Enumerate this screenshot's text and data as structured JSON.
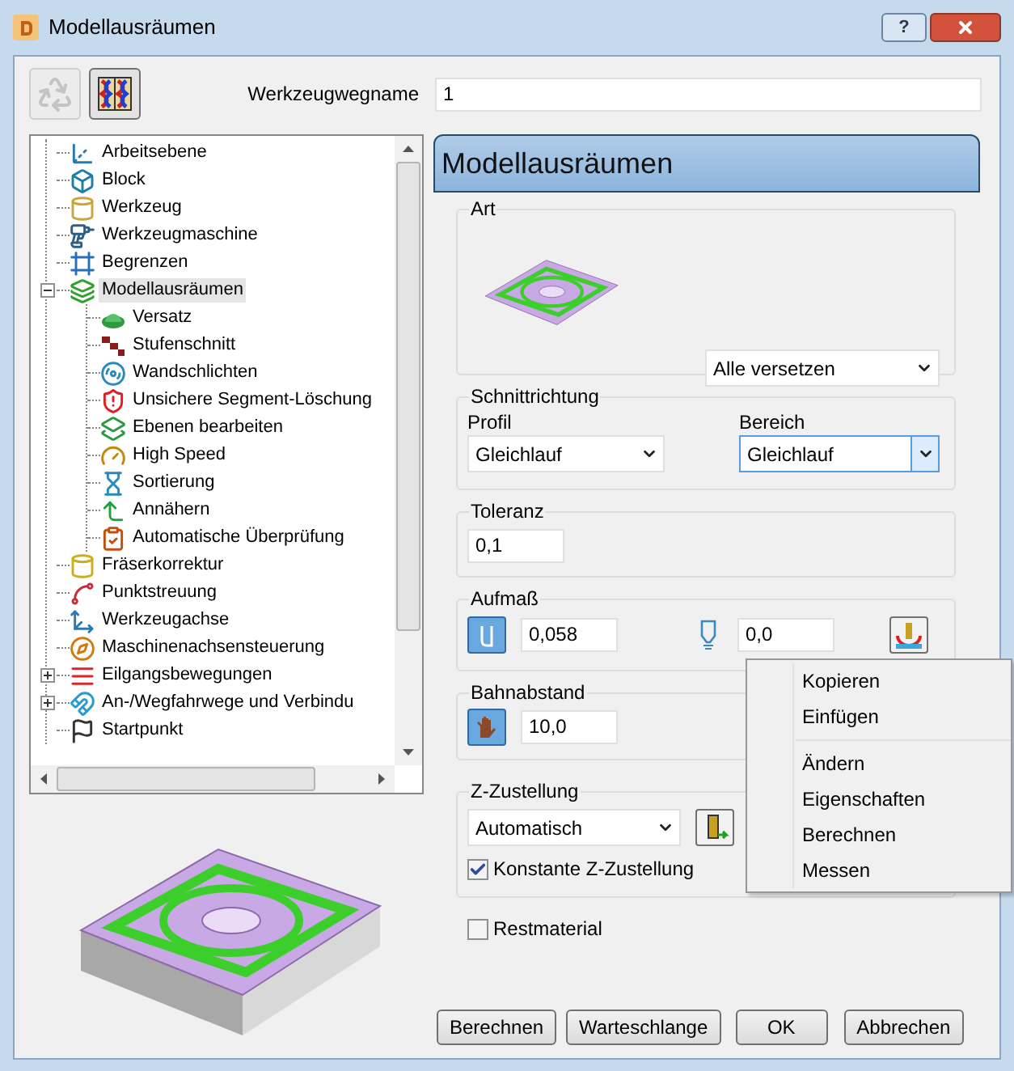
{
  "window": {
    "title": "Modellausräumen",
    "help": "?"
  },
  "toolbar": [
    {
      "disabled": true
    },
    {
      "disabled": false
    }
  ],
  "name_field": {
    "label": "Werkzeugwegname",
    "value": "1"
  },
  "tree": {
    "items": [
      {
        "label": "Arbeitsebene",
        "selected": false
      },
      {
        "label": "Block",
        "selected": false
      },
      {
        "label": "Werkzeug",
        "selected": false
      },
      {
        "label": "Werkzeugmaschine",
        "selected": false
      },
      {
        "label": "Begrenzen",
        "selected": false
      },
      {
        "label": "Modellausräumen",
        "selected": true,
        "expanded": true,
        "children": [
          {
            "label": "Versatz",
            "selected": false
          },
          {
            "label": "Stufenschnitt",
            "selected": false
          },
          {
            "label": "Wandschlichten",
            "selected": false
          },
          {
            "label": "Unsichere Segment-Löschung",
            "selected": false
          },
          {
            "label": "Ebenen bearbeiten",
            "selected": false
          },
          {
            "label": "High Speed",
            "selected": false
          },
          {
            "label": "Sortierung",
            "selected": false
          },
          {
            "label": "Annähern",
            "selected": false
          },
          {
            "label": "Automatische Überprüfung",
            "selected": false
          }
        ]
      },
      {
        "label": "Fräserkorrektur",
        "selected": false
      },
      {
        "label": "Punktstreuung",
        "selected": false
      },
      {
        "label": "Werkzeugachse",
        "selected": false
      },
      {
        "label": "Maschinenachsensteuerung",
        "selected": false
      },
      {
        "label": "Eilgangsbewegungen",
        "selected": false,
        "expanded": false
      },
      {
        "label": "An-/Wegfahrwege und Verbindu",
        "selected": false,
        "expanded": false
      },
      {
        "label": "Startpunkt",
        "selected": false
      }
    ]
  },
  "panel": {
    "title": "Modellausräumen",
    "art": {
      "legend": "Art",
      "dropdown": "Alle versetzen"
    },
    "schnittrichtung": {
      "legend": "Schnittrichtung",
      "fields": [
        {
          "label": "Profil",
          "value": "Gleichlauf",
          "focused": false
        },
        {
          "label": "Bereich",
          "value": "Gleichlauf",
          "focused": true
        }
      ]
    },
    "toleranz": {
      "legend": "Toleranz",
      "value": "0,1"
    },
    "aufmass": {
      "legend": "Aufmaß",
      "radial": "0,058",
      "axial": "0,0"
    },
    "bahnabstand": {
      "legend": "Bahnabstand",
      "value": "10,0"
    },
    "z_zustellung": {
      "legend": "Z-Zustellung",
      "dropdown": "Automatisch",
      "checkbox": {
        "label": "Konstante Z-Zustellung",
        "checked": true
      }
    },
    "restmaterial": {
      "label": "Restmaterial",
      "checked": false
    }
  },
  "buttons": [
    "Berechnen",
    "Warteschlange",
    "OK",
    "Abbrechen"
  ],
  "context_menu": [
    [
      "Kopieren",
      "Einfügen"
    ],
    [
      "Ändern",
      "Eigenschaften",
      "Berechnen",
      "Messen"
    ]
  ]
}
